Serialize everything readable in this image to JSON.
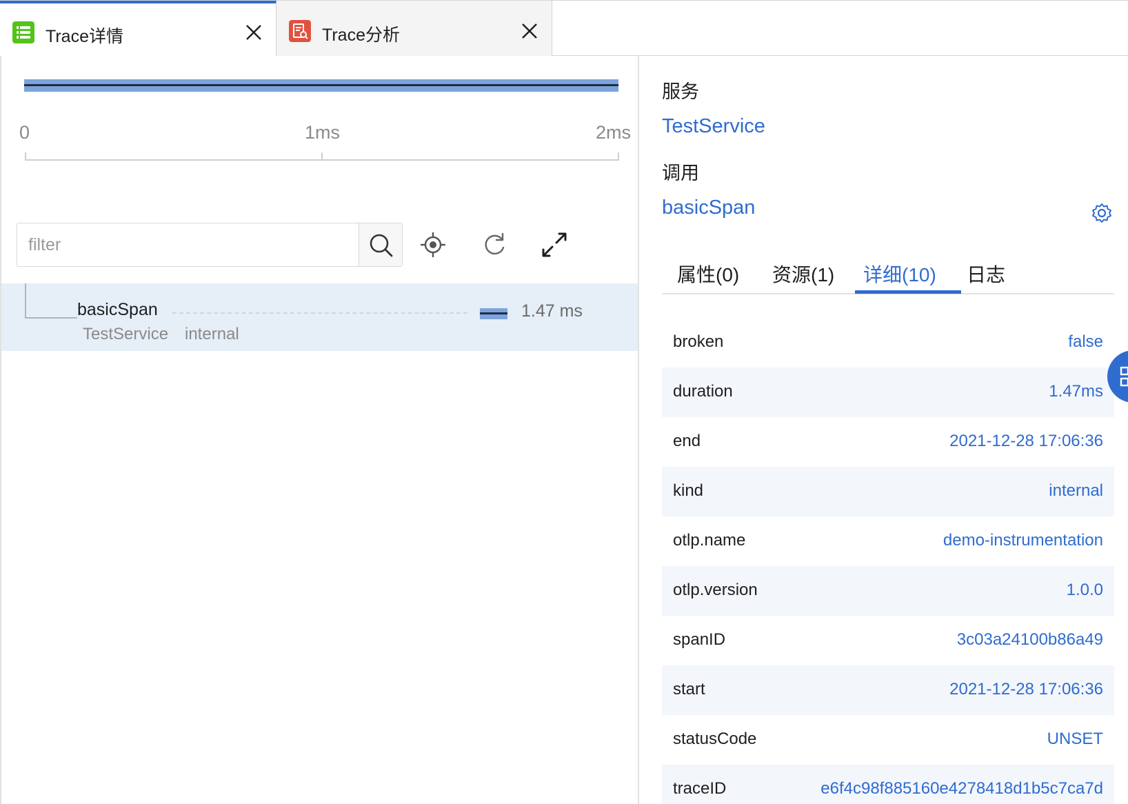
{
  "tabs": [
    {
      "title": "Trace详情",
      "active": true,
      "icon": "list-icon",
      "icon_color": "#52c41a"
    },
    {
      "title": "Trace分析",
      "active": false,
      "icon": "analysis-icon",
      "icon_color": "#e0523f"
    }
  ],
  "timeline": {
    "ruler": [
      "0",
      "1ms",
      "2ms"
    ]
  },
  "filter": {
    "placeholder": "filter",
    "value": ""
  },
  "toolbar": {
    "icons": [
      "search-icon",
      "locate-icon",
      "refresh-icon",
      "expand-icon"
    ]
  },
  "span": {
    "name": "basicSpan",
    "duration": "1.47 ms",
    "service": "TestService",
    "kind": "internal"
  },
  "detail_panel": {
    "service_label": "服务",
    "service_value": "TestService",
    "call_label": "调用",
    "call_value": "basicSpan",
    "tabs": [
      {
        "label": "属性(0)",
        "active": false
      },
      {
        "label": "资源(1)",
        "active": false
      },
      {
        "label": "详细(10)",
        "active": true
      },
      {
        "label": "日志",
        "active": false
      }
    ],
    "rows": [
      {
        "key": "broken",
        "value": "false"
      },
      {
        "key": "duration",
        "value": "1.47ms"
      },
      {
        "key": "end",
        "value": "2021-12-28 17:06:36"
      },
      {
        "key": "kind",
        "value": "internal"
      },
      {
        "key": "otlp.name",
        "value": "demo-instrumentation"
      },
      {
        "key": "otlp.version",
        "value": "1.0.0"
      },
      {
        "key": "spanID",
        "value": "3c03a24100b86a49"
      },
      {
        "key": "start",
        "value": "2021-12-28 17:06:36"
      },
      {
        "key": "statusCode",
        "value": "UNSET"
      },
      {
        "key": "traceID",
        "value": "e6f4c98f885160e4278418d1b5c7ca7d"
      }
    ]
  },
  "colors": {
    "accent": "#2f6ccf",
    "span_bar": "#7ea3db",
    "selected_row": "#e6eef8"
  }
}
